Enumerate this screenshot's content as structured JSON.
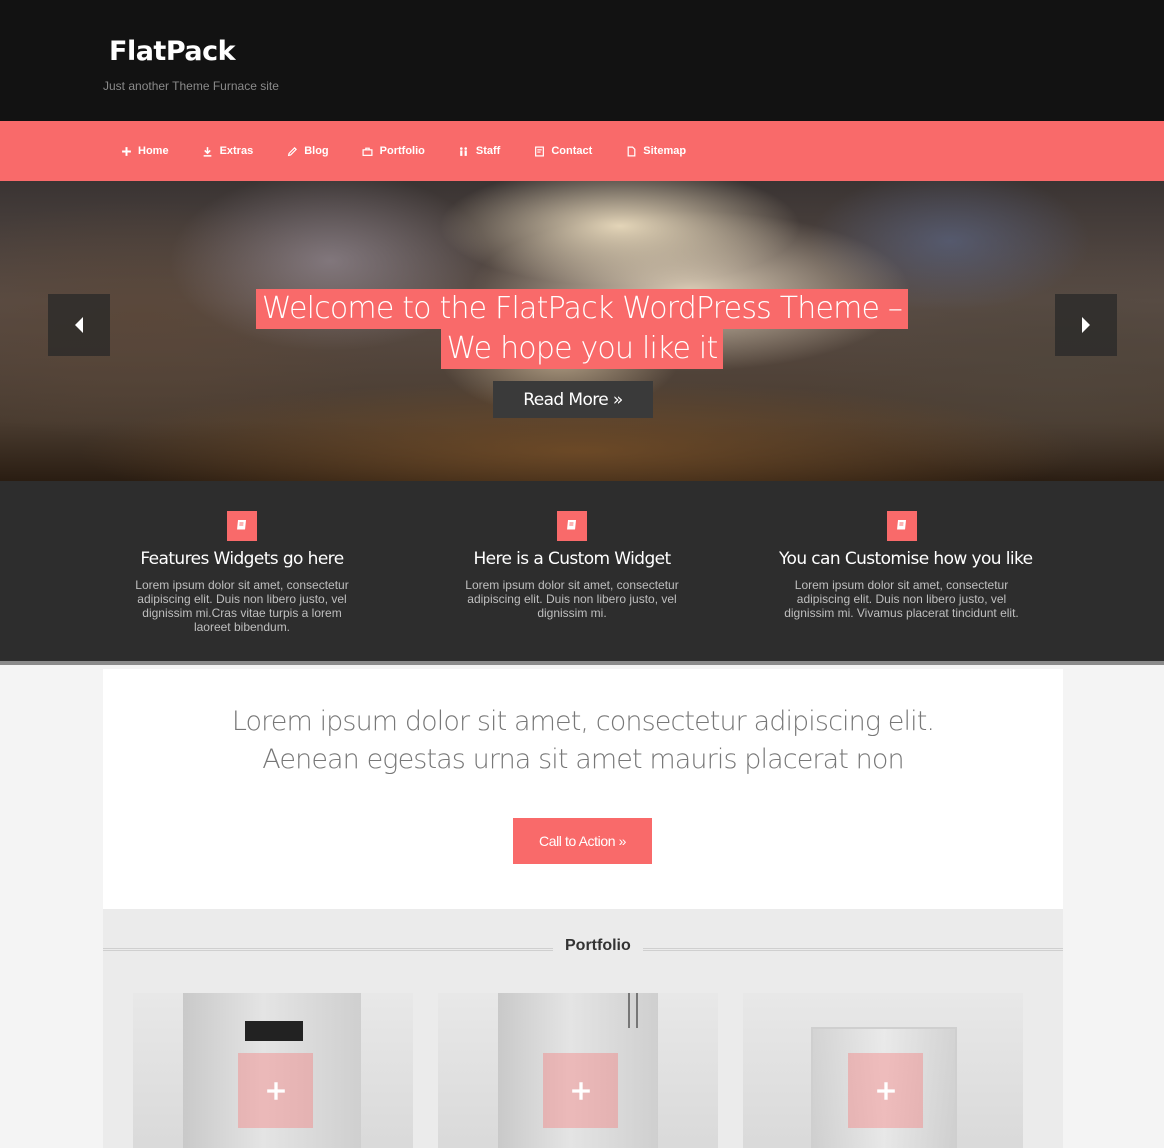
{
  "header": {
    "site_title": "FlatPack",
    "tagline": "Just another Theme Furnace site"
  },
  "nav": {
    "items": [
      {
        "label": "Home",
        "icon": "plus-icon"
      },
      {
        "label": "Extras",
        "icon": "download-icon"
      },
      {
        "label": "Blog",
        "icon": "pencil-icon"
      },
      {
        "label": "Portfolio",
        "icon": "briefcase-icon"
      },
      {
        "label": "Staff",
        "icon": "people-icon"
      },
      {
        "label": "Contact",
        "icon": "contact-card-icon"
      },
      {
        "label": "Sitemap",
        "icon": "document-icon"
      }
    ]
  },
  "hero": {
    "title_line1": "Welcome to the FlatPack WordPress Theme –",
    "title_line2": "We hope you like it",
    "button_label": "Read More »"
  },
  "widgets": [
    {
      "title": "Features Widgets go here",
      "text": "Lorem ipsum dolor sit amet, consectetur adipiscing elit. Duis non libero justo, vel dignissim mi.Cras vitae turpis a lorem laoreet bibendum.",
      "icon": "book-icon"
    },
    {
      "title": "Here is a Custom Widget",
      "text": "Lorem ipsum dolor sit amet, consectetur adipiscing elit. Duis non libero justo, vel dignissim mi.",
      "icon": "book-icon"
    },
    {
      "title": "You can Customise how you like",
      "text": "Lorem ipsum dolor sit amet, consectetur adipiscing elit. Duis non libero justo, vel dignissim mi. Vivamus placerat tincidunt elit.",
      "icon": "book-icon"
    }
  ],
  "content": {
    "lead_line1": "Lorem ipsum dolor sit amet, consectetur adipiscing elit.",
    "lead_line2": "Aenean egestas urna sit amet mauris placerat non",
    "cta_label": "Call to Action »"
  },
  "portfolio": {
    "heading": "Portfolio"
  },
  "colors": {
    "accent": "#f96a6a",
    "header_bg": "#121212",
    "widgets_bg": "#2d2d2d"
  }
}
